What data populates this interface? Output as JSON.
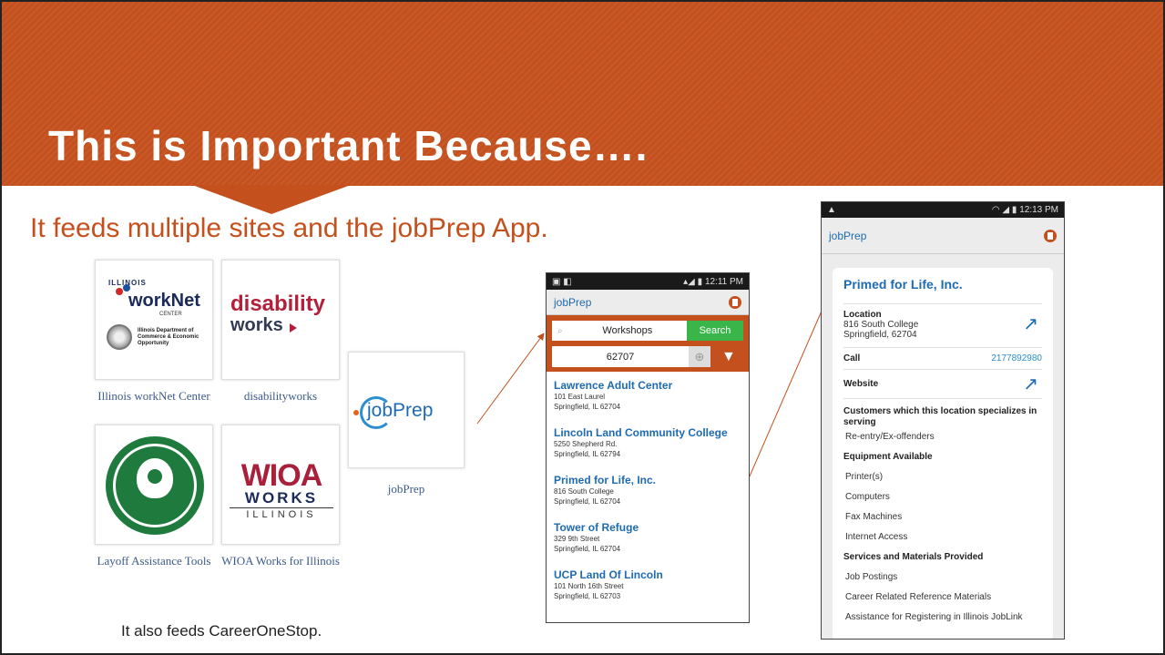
{
  "title": "This is Important Because….",
  "subtitle": "It feeds multiple sites and the jobPrep App.",
  "footnote": "It also feeds CareerOneStop.",
  "tiles": [
    {
      "logo_top": "ILLINOIS",
      "logo_main": "workNet",
      "logo_sub": "CENTER",
      "seal_text": "Illinois Department of Commerce & Economic Opportunity",
      "caption": "Illinois workNet Center"
    },
    {
      "logo_line1": "disability",
      "logo_line2": "works",
      "caption": "disabilityworks"
    },
    {
      "logo_main": "jobPrep",
      "caption": "jobPrep"
    },
    {
      "caption": "Layoff Assistance Tools"
    },
    {
      "logo_line1": "WIOA",
      "logo_line2": "WORKS",
      "logo_line3": "ILLINOIS",
      "caption": "WIOA Works for Illinois"
    }
  ],
  "phone1": {
    "time": "12:11 PM",
    "app_name": "jobPrep",
    "search_value": "Workshops",
    "search_button": "Search",
    "zip_value": "62707",
    "results": [
      {
        "name": "Lawrence Adult Center",
        "street": "101 East Laurel",
        "city": "Springfield, IL 62704"
      },
      {
        "name": "Lincoln Land Community College",
        "street": "5250 Shepherd Rd.",
        "city": "Springfield, IL 62794"
      },
      {
        "name": "Primed for Life, Inc.",
        "street": "816 South College",
        "city": "Springfield, IL 62704"
      },
      {
        "name": "Tower of Refuge",
        "street": "329 9th Street",
        "city": "Springfield, IL 62704"
      },
      {
        "name": "UCP Land Of Lincoln",
        "street": "101 North 16th Street",
        "city": "Springfield, IL 62703"
      }
    ]
  },
  "phone2": {
    "time": "12:13 PM",
    "app_name": "jobPrep",
    "org_name": "Primed for Life, Inc.",
    "location_label": "Location",
    "address_line1": "816 South College",
    "address_line2": "Springfield, 62704",
    "call_label": "Call",
    "phone_number": "2177892980",
    "website_label": "Website",
    "customers_label": "Customers which this location specializes in serving",
    "customers": [
      "Re-entry/Ex-offenders"
    ],
    "equipment_label": "Equipment Available",
    "equipment": [
      "Printer(s)",
      "Computers",
      "Fax Machines",
      "Internet Access"
    ],
    "services_label": "Services and Materials Provided",
    "services": [
      "Job Postings",
      "Career Related Reference Materials",
      "Assistance for Registering in Illinois JobLink"
    ]
  },
  "colors": {
    "accent": "#c4501d",
    "link": "#1e6bb3",
    "search_green": "#39b54a"
  }
}
